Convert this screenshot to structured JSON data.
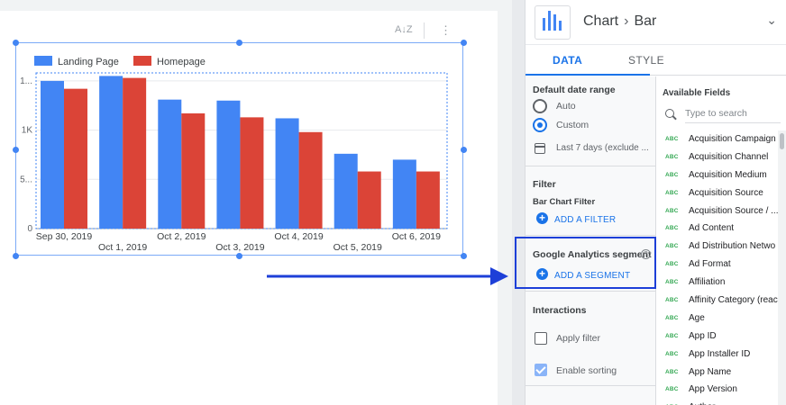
{
  "toolbar": {
    "sort_icon": "sort-az-icon",
    "sort_label": "A↓Z",
    "more_icon": "more-vertical-icon",
    "more_label": "⋮"
  },
  "chart_data": {
    "type": "bar",
    "series": [
      {
        "name": "Landing Page",
        "color": "#4285f4",
        "values": [
          1500,
          1550,
          1310,
          1300,
          1120,
          760,
          700
        ]
      },
      {
        "name": "Homepage",
        "color": "#db4437",
        "values": [
          1420,
          1530,
          1170,
          1130,
          980,
          580,
          580
        ]
      }
    ],
    "categories": [
      "Sep 30, 2019",
      "Oct 1, 2019",
      "Oct 2, 2019",
      "Oct 3, 2019",
      "Oct 4, 2019",
      "Oct 5, 2019",
      "Oct 6, 2019"
    ],
    "ytick_labels": [
      "0",
      "5...",
      "1K",
      "1..."
    ],
    "yticks": [
      0,
      500,
      1000,
      1500
    ],
    "ylim": [
      0,
      1700
    ],
    "legend": "top-left",
    "grid": true
  },
  "panel": {
    "title": "Chart",
    "subtitle": "Bar",
    "collapse_icon": "chevron-down-icon",
    "tabs": [
      {
        "label": "DATA"
      },
      {
        "label": "STYLE"
      }
    ],
    "date_range": {
      "title": "Default date range",
      "options": [
        {
          "label": "Auto",
          "selected": false
        },
        {
          "label": "Custom",
          "selected": true
        }
      ],
      "value": "Last 7 days (exclude ..."
    },
    "filter": {
      "title": "Filter",
      "subtitle": "Bar Chart Filter",
      "add_label": "ADD A FILTER"
    },
    "segment": {
      "title": "Google Analytics segment",
      "help_label": "?",
      "add_label": "ADD A SEGMENT"
    },
    "interactions": {
      "title": "Interactions",
      "options": [
        {
          "label": "Apply filter",
          "checked": false
        },
        {
          "label": "Enable sorting",
          "checked": true
        }
      ]
    },
    "available": {
      "title": "Available Fields",
      "search_placeholder": "Type to search",
      "type_badge": "ABC",
      "fields": [
        "Acquisition Campaign",
        "Acquisition Channel",
        "Acquisition Medium",
        "Acquisition Source",
        "Acquisition Source / ...",
        "Ad Content",
        "Ad Distribution Netwo",
        "Ad Format",
        "Affiliation",
        "Affinity Category (reac",
        "Age",
        "App ID",
        "App Installer ID",
        "App Name",
        "App Version",
        "Author"
      ]
    }
  },
  "colors": {
    "accent": "#1a73e8",
    "highlight_box": "#1d3fd8",
    "arrow": "#1d3fd8"
  }
}
